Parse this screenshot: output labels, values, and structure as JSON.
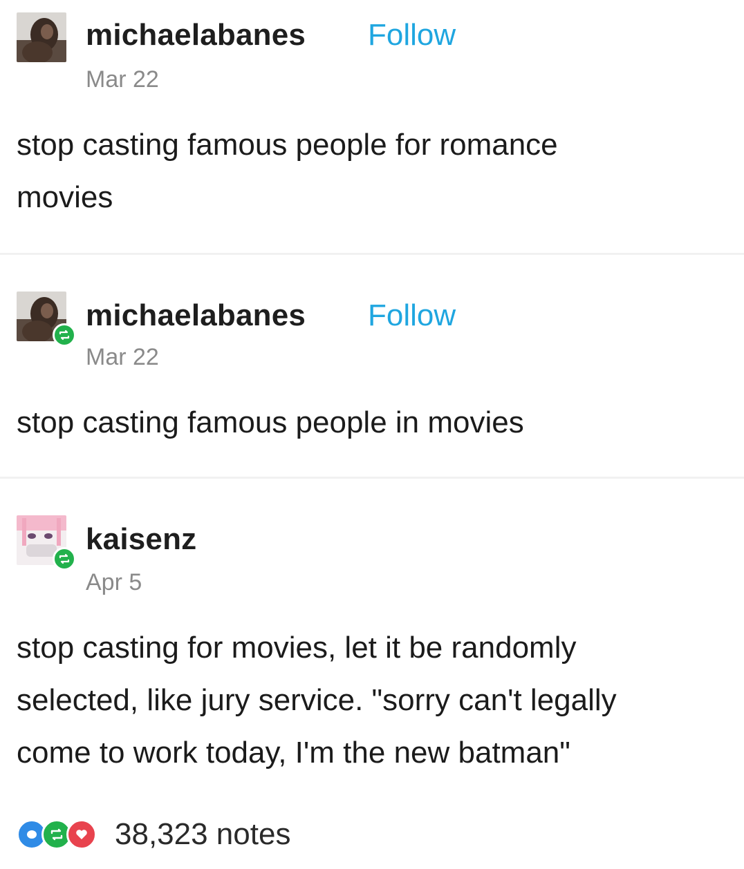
{
  "posts": [
    {
      "username": "michaelabanes",
      "follow_label": "Follow",
      "date": "Mar 22",
      "lines": [
        "stop casting famous people for romance",
        "movies"
      ],
      "reblog": false
    },
    {
      "username": "michaelabanes",
      "follow_label": "Follow",
      "date": "Mar 22",
      "lines": [
        "stop casting famous people in movies"
      ],
      "reblog": true
    },
    {
      "username": "kaisenz",
      "date": "Apr 5",
      "lines": [
        "stop casting for movies, let it be randomly",
        "selected, like jury service. \"sorry can't legally",
        "come to work today, I'm the new batman\""
      ],
      "reblog": true
    }
  ],
  "footer": {
    "notes_label": "38,323 notes"
  },
  "colors": {
    "follow": "#1fa6e0",
    "reblog_green": "#22b14c",
    "like_red": "#e8434e",
    "reply_blue": "#2f8be6"
  }
}
